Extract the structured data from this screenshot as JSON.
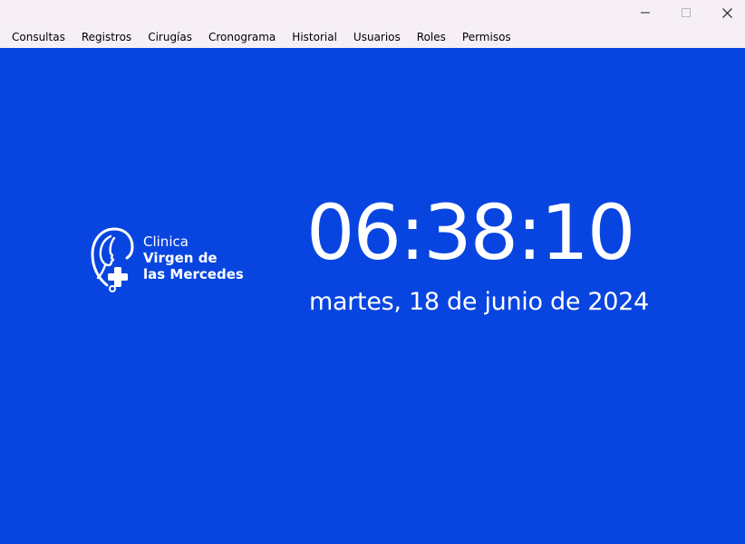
{
  "window": {
    "controls": {
      "minimize_icon": "minimize-icon",
      "maximize_icon": "maximize-icon",
      "close_icon": "close-icon"
    }
  },
  "menu": {
    "items": [
      {
        "label": "Consultas"
      },
      {
        "label": "Registros"
      },
      {
        "label": "Cirugías"
      },
      {
        "label": "Cronograma"
      },
      {
        "label": "Historial"
      },
      {
        "label": "Usuarios"
      },
      {
        "label": "Roles"
      },
      {
        "label": "Permisos"
      }
    ]
  },
  "main": {
    "background_color": "#0845e0",
    "logo": {
      "line1": "Clinica",
      "line2": "Virgen de",
      "line3": "las Mercedes"
    },
    "clock": "06:38:10",
    "date": "martes, 18 de junio de 2024"
  }
}
